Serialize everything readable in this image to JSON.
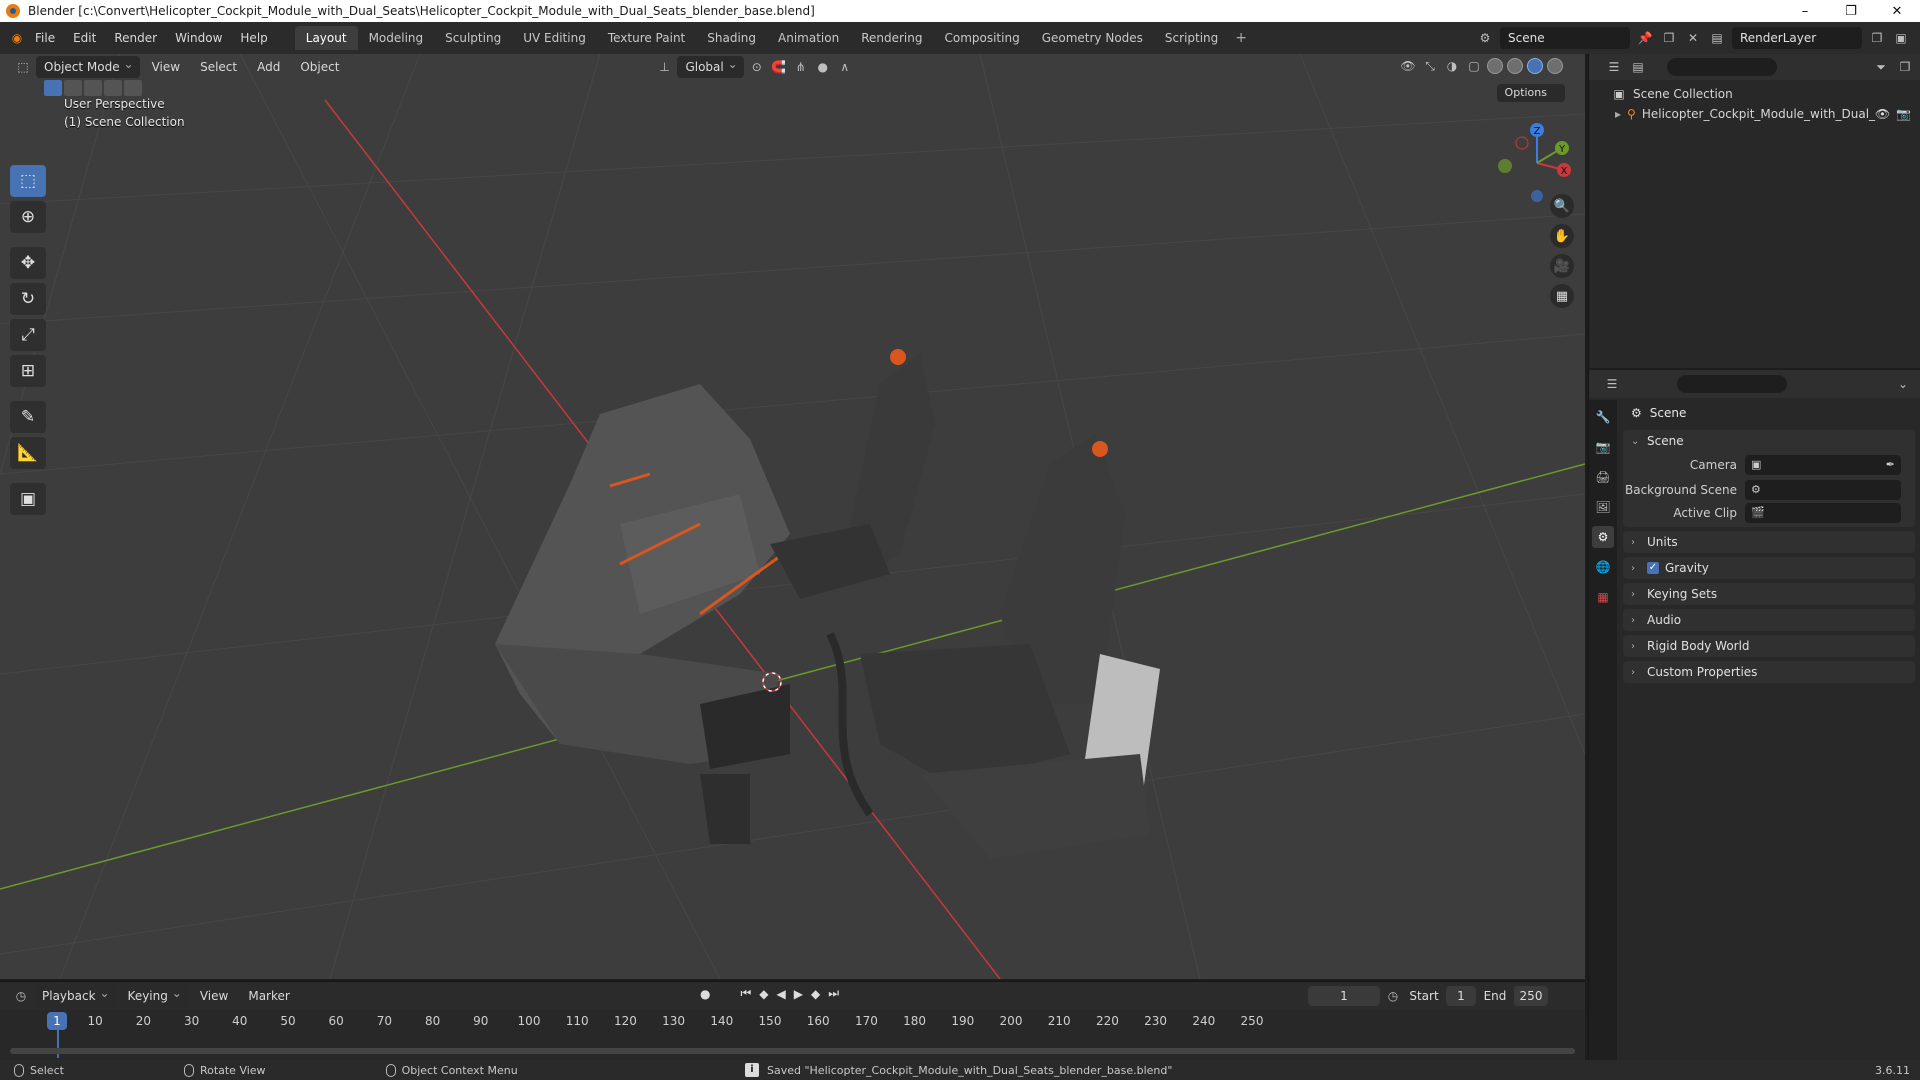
{
  "window": {
    "title": "Blender [c:\\Convert\\Helicopter_Cockpit_Module_with_Dual_Seats\\Helicopter_Cockpit_Module_with_Dual_Seats_blender_base.blend]",
    "minimize": "–",
    "maximize": "❐",
    "close": "✕"
  },
  "menu": [
    "File",
    "Edit",
    "Render",
    "Window",
    "Help"
  ],
  "workspaces": [
    "Layout",
    "Modeling",
    "Sculpting",
    "UV Editing",
    "Texture Paint",
    "Shading",
    "Animation",
    "Rendering",
    "Compositing",
    "Geometry Nodes",
    "Scripting"
  ],
  "workspace_add": "+",
  "scene_name": "Scene",
  "view_layer": "RenderLayer",
  "viewport": {
    "mode": "Object Mode",
    "menus": [
      "View",
      "Select",
      "Add",
      "Object"
    ],
    "orientation": "Global",
    "options_label": "Options",
    "info_line1": "User Perspective",
    "info_line2": "(1) Scene Collection",
    "gizmo_axes": [
      "X",
      "Y",
      "Z"
    ]
  },
  "outliner": {
    "root": "Scene Collection",
    "child": "Helicopter_Cockpit_Module_with_Dual_"
  },
  "properties": {
    "context_title": "Scene",
    "panel_scene": "Scene",
    "camera_label": "Camera",
    "background_scene_label": "Background Scene",
    "active_clip_label": "Active Clip",
    "collapsed_panels": [
      "Units",
      "Gravity",
      "Keying Sets",
      "Audio",
      "Rigid Body World",
      "Custom Properties"
    ],
    "gravity_checked": true
  },
  "timeline": {
    "menus": [
      "Playback",
      "Keying",
      "View",
      "Marker"
    ],
    "current_frame": "1",
    "start_label": "Start",
    "start_value": "1",
    "end_label": "End",
    "end_value": "250",
    "ruler_ticks": [
      "10",
      "20",
      "30",
      "40",
      "50",
      "60",
      "70",
      "80",
      "90",
      "100",
      "110",
      "120",
      "130",
      "140",
      "150",
      "160",
      "170",
      "180",
      "190",
      "200",
      "210",
      "220",
      "230",
      "240",
      "250"
    ]
  },
  "status": {
    "select": "Select",
    "rotate": "Rotate View",
    "context_menu": "Object Context Menu",
    "message": "Saved \"Helicopter_Cockpit_Module_with_Dual_Seats_blender_base.blend\"",
    "version": "3.6.11"
  },
  "colors": {
    "accent": "#4772b3",
    "x_axis": "#c8383d",
    "y_axis": "#6b9a2b",
    "z_axis": "#3c7de0",
    "model_orange": "#d9561f"
  }
}
